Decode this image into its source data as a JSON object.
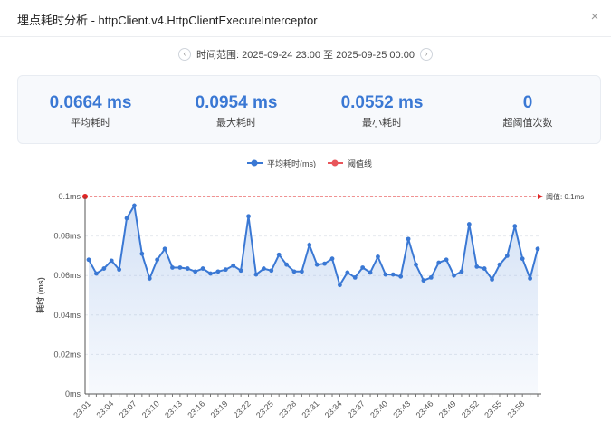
{
  "dialog": {
    "title": "埋点耗时分析 - httpClient.v4.HttpClientExecuteInterceptor",
    "close_glyph": "×"
  },
  "time_range": {
    "label": "时间范围: 2025-09-24 23:00 至 2025-09-25 00:00",
    "prev_glyph": "‹",
    "next_glyph": "›"
  },
  "stats": [
    {
      "value": "0.0664 ms",
      "label": "平均耗时"
    },
    {
      "value": "0.0954 ms",
      "label": "最大耗时"
    },
    {
      "value": "0.0552 ms",
      "label": "最小耗时"
    },
    {
      "value": "0",
      "label": "超阈值次数"
    }
  ],
  "colors": {
    "accent": "#3a78d4",
    "threshold": "#e02424",
    "grid": "#e6e9ee"
  },
  "chart_data": {
    "type": "line",
    "legend": [
      "平均耗时(ms)",
      "阈值线"
    ],
    "ylabel": "耗时 (ms)",
    "ylim": [
      0,
      0.1
    ],
    "yticks": [
      "0ms",
      "0.02ms",
      "0.04ms",
      "0.06ms",
      "0.08ms",
      "0.1ms"
    ],
    "ytick_values": [
      0,
      0.02,
      0.04,
      0.06,
      0.08,
      0.1
    ],
    "threshold": {
      "value": 0.1,
      "label": "阈值: 0.1ms"
    },
    "xtick_labels": [
      "23:01",
      "23:04",
      "23:07",
      "23:10",
      "23:13",
      "23:16",
      "23:19",
      "23:22",
      "23:25",
      "23:28",
      "23:31",
      "23:34",
      "23:37",
      "23:40",
      "23:43",
      "23:46",
      "23:49",
      "23:52",
      "23:55",
      "23:58"
    ],
    "xtick_indices": [
      0,
      3,
      6,
      9,
      12,
      15,
      18,
      21,
      24,
      27,
      30,
      33,
      36,
      39,
      42,
      45,
      48,
      51,
      54,
      57
    ],
    "series": [
      {
        "name": "平均耗时(ms)",
        "values": [
          0.068,
          0.061,
          0.0635,
          0.0675,
          0.063,
          0.089,
          0.0954,
          0.071,
          0.0585,
          0.068,
          0.0735,
          0.064,
          0.064,
          0.0635,
          0.062,
          0.0635,
          0.061,
          0.062,
          0.063,
          0.065,
          0.0625,
          0.09,
          0.0605,
          0.0635,
          0.0625,
          0.0705,
          0.0655,
          0.062,
          0.062,
          0.0755,
          0.0655,
          0.066,
          0.0685,
          0.0552,
          0.0615,
          0.059,
          0.064,
          0.0615,
          0.0695,
          0.0605,
          0.0605,
          0.0595,
          0.0785,
          0.0655,
          0.0575,
          0.059,
          0.0665,
          0.068,
          0.06,
          0.062,
          0.086,
          0.0645,
          0.0635,
          0.058,
          0.0655,
          0.07,
          0.085,
          0.0685,
          0.0585,
          0.0735
        ]
      }
    ]
  }
}
